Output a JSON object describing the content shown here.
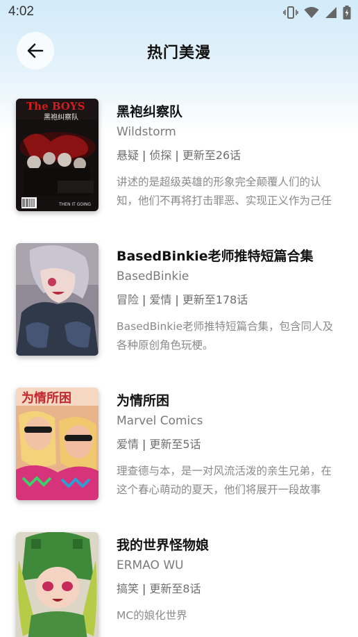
{
  "status": {
    "time": "4:02",
    "icons": [
      "vibrate-icon",
      "wifi-icon",
      "signal-icon",
      "battery-charging-icon"
    ]
  },
  "header": {
    "title": "热门美漫",
    "back_icon": "arrow-left-icon"
  },
  "items": [
    {
      "title": "黑袍纠察队",
      "author": "Wildstorm",
      "tags": [
        "悬疑",
        "侦探",
        "更新至26话"
      ],
      "description": "讲述的是超级英雄的形象完全颠覆人们的认知，他们不再将打击罪恶、实现正义作为己任",
      "cover": {
        "text_top": "The BOYS",
        "text_sub": "黑袍纠察队",
        "bottom": "THEN IT GOING"
      }
    },
    {
      "title": "BasedBinkie老师推特短篇合集",
      "author": "BasedBinkie",
      "tags": [
        "冒险",
        "爱情",
        "更新至178话"
      ],
      "description": "BasedBinkie老师推特短篇合集，包含同人及各种原创角色玩梗。",
      "cover": {}
    },
    {
      "title": "为情所困",
      "author": "Marvel Comics",
      "tags": [
        "爱情",
        "更新至5话"
      ],
      "description": "理查德与本，是一对风流活泼的亲生兄弟，在这个春心萌动的夏天，他们将展开一段故事",
      "cover": {
        "text_top": "为情所困"
      }
    },
    {
      "title": "我的世界怪物娘",
      "author": "ERMAO WU",
      "tags": [
        "搞笑",
        "更新至8话"
      ],
      "description": "MC的娘化世界",
      "cover": {}
    }
  ]
}
